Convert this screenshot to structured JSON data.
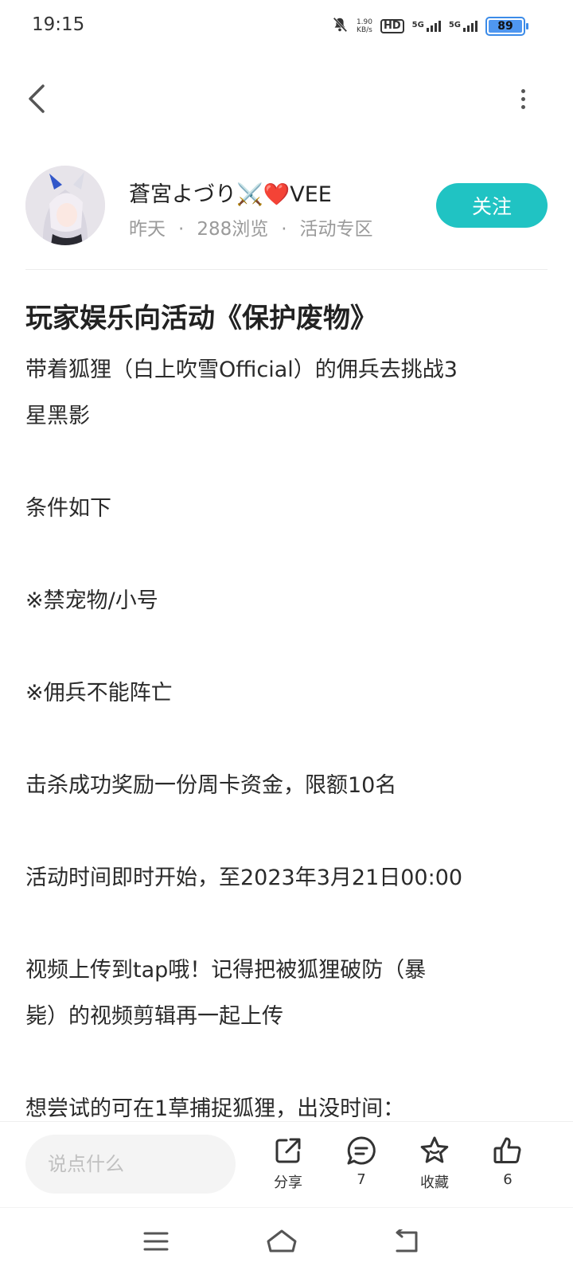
{
  "status_bar": {
    "time": "19:15",
    "net_speed_value": "1.90",
    "net_speed_unit": "KB/s",
    "hd_label": "HD",
    "sim1_label": "5G",
    "sim2_label": "5G",
    "battery_level": "89"
  },
  "author": {
    "name": "蒼宮よづり⚔️❤️VEE",
    "date": "昨天",
    "views": "288浏览",
    "section": "活动专区",
    "follow_label": "关注"
  },
  "post": {
    "title": "玩家娱乐向活动《保护废物》",
    "lines": [
      "带着狐狸（白上吹雪Official）的佣兵去挑战3",
      "星黑影",
      "",
      "条件如下",
      "",
      "※禁宠物/小号",
      "",
      "※佣兵不能阵亡",
      "",
      "击杀成功奖励一份周卡资金，限额10名",
      "",
      "活动时间即时开始，至2023年3月21日00:00",
      "",
      "视频上传到tap哦！记得把被狐狸破防（暴",
      "毙）的视频剪辑再一起上传",
      "",
      "想尝试的可在1草捕捉狐狸，出没时间："
    ]
  },
  "action_bar": {
    "comment_placeholder": "说点什么",
    "share_label": "分享",
    "comment_count": "7",
    "favorite_label": "收藏",
    "like_count": "6"
  },
  "colors": {
    "accent": "#20c3c3",
    "battery": "#4f97f0"
  }
}
